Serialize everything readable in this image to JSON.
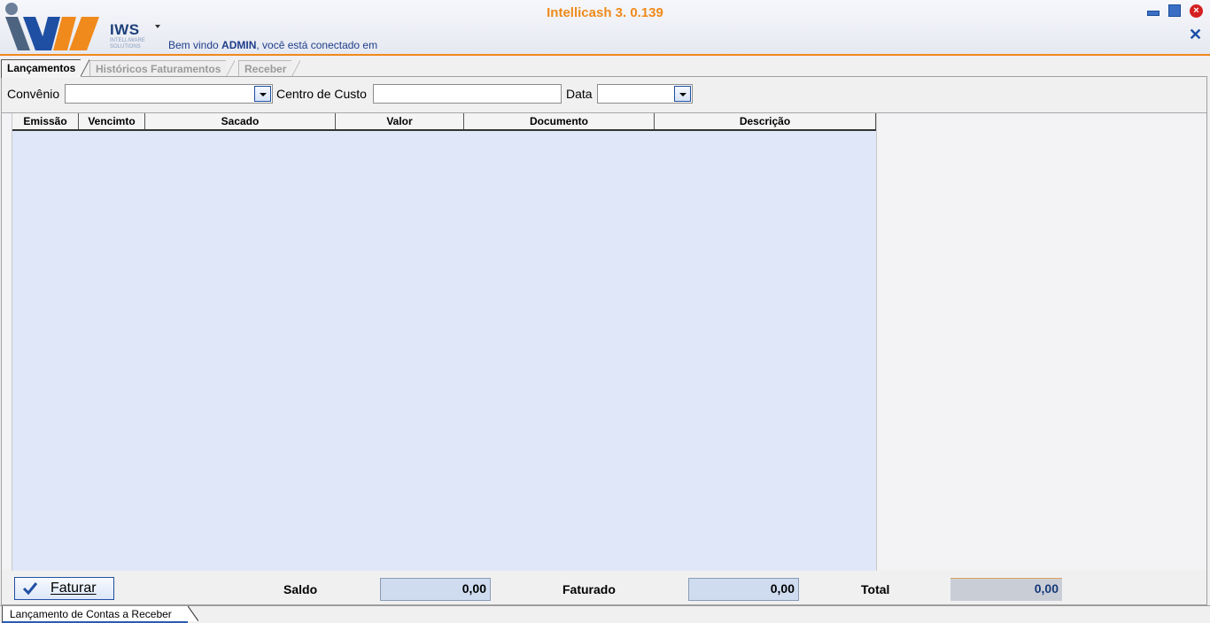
{
  "header": {
    "app_title": "Intellicash 3. 0.139",
    "logo_text": "IWS",
    "logo_subtext": "INTELLIWARE SOLUTIONS",
    "welcome_prefix": "Bem vindo ",
    "welcome_user": "ADMIN",
    "welcome_suffix": ", você está conectado em",
    "close_symbol": "×",
    "close_app_symbol": "✕"
  },
  "tabs": [
    {
      "label": "Lançamentos",
      "active": true
    },
    {
      "label": "Históricos Faturamentos",
      "active": false
    },
    {
      "label": "Receber",
      "active": false
    }
  ],
  "filters": {
    "convenio_label": "Convênio",
    "convenio_value": "",
    "centro_label": "Centro de Custo",
    "centro_value": "",
    "data_label": "Data",
    "data_value": ""
  },
  "grid": {
    "columns": [
      "Emissão",
      "Vencimto",
      "Sacado",
      "Valor",
      "Documento",
      "Descrição"
    ],
    "rows": []
  },
  "bottom": {
    "faturar_label": "Faturar",
    "saldo_label": "Saldo",
    "saldo_value": "0,00",
    "faturado_label": "Faturado",
    "faturado_value": "0,00",
    "total_label": "Total",
    "total_value": "0,00"
  },
  "status": {
    "tab_label": "Lançamento de Contas a Receber"
  },
  "colors": {
    "accent_orange": "#ef8a1a",
    "brand_blue": "#1d3f7a",
    "grid_background": "#dfe7f8"
  }
}
